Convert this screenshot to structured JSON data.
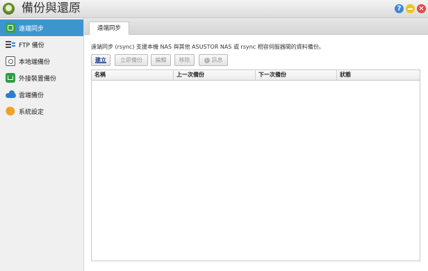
{
  "window": {
    "title": "備份與還原",
    "controls": {
      "help": "?"
    }
  },
  "sidebar": {
    "items": [
      {
        "label": "遠端同步",
        "icon": "remote-sync-icon",
        "active": true
      },
      {
        "label": "FTP 備份",
        "icon": "ftp-icon",
        "active": false
      },
      {
        "label": "本地端備份",
        "icon": "local-disk-icon",
        "active": false
      },
      {
        "label": "外接裝置備份",
        "icon": "external-device-icon",
        "active": false
      },
      {
        "label": "雲端備份",
        "icon": "cloud-icon",
        "active": false
      },
      {
        "label": "系統設定",
        "icon": "gear-icon",
        "active": false
      }
    ]
  },
  "main": {
    "tab": "遠端同步",
    "description": "遠端同步 (rsync) 支援本機 NAS 與其他 ASUSTOR NAS 或 rsync 相容伺服器間的資料備份。",
    "toolbar": {
      "create": "建立",
      "backup_now": "立即備份",
      "edit": "編輯",
      "remove": "移除",
      "info": "訊息"
    },
    "table": {
      "columns": [
        "名稱",
        "上一次備份",
        "下一次備份",
        "狀態"
      ],
      "rows": []
    }
  },
  "colors": {
    "accent": "#3c95cf",
    "help": "#3f86d6",
    "minimize": "#f3c21e",
    "close": "#e54848"
  }
}
